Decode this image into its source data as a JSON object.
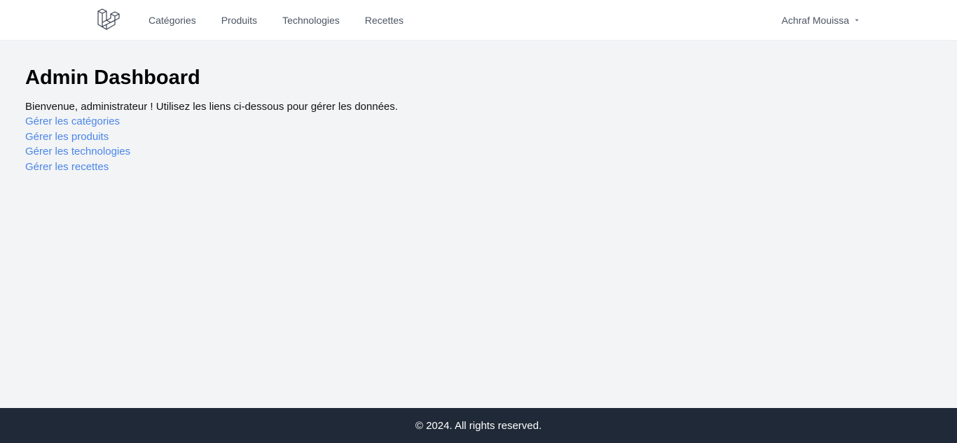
{
  "nav": {
    "logo_icon": "laravel-logo-icon",
    "links": [
      {
        "label": "Catégories"
      },
      {
        "label": "Produits"
      },
      {
        "label": "Technologies"
      },
      {
        "label": "Recettes"
      }
    ],
    "user": {
      "name": "Achraf Mouissa",
      "icon": "caret-down-icon"
    }
  },
  "main": {
    "title": "Admin Dashboard",
    "intro": "Bienvenue, administrateur ! Utilisez les liens ci-dessous pour gérer les données.",
    "links": [
      {
        "label": "Gérer les catégories"
      },
      {
        "label": "Gérer les produits"
      },
      {
        "label": "Gérer les technologies"
      },
      {
        "label": "Gérer les recettes"
      }
    ]
  },
  "footer": {
    "text": "© 2024. All rights reserved."
  },
  "colors": {
    "nav_bg": "#ffffff",
    "page_bg": "#f3f4f6",
    "link": "#4a86e8",
    "footer_bg": "#1f2937"
  }
}
